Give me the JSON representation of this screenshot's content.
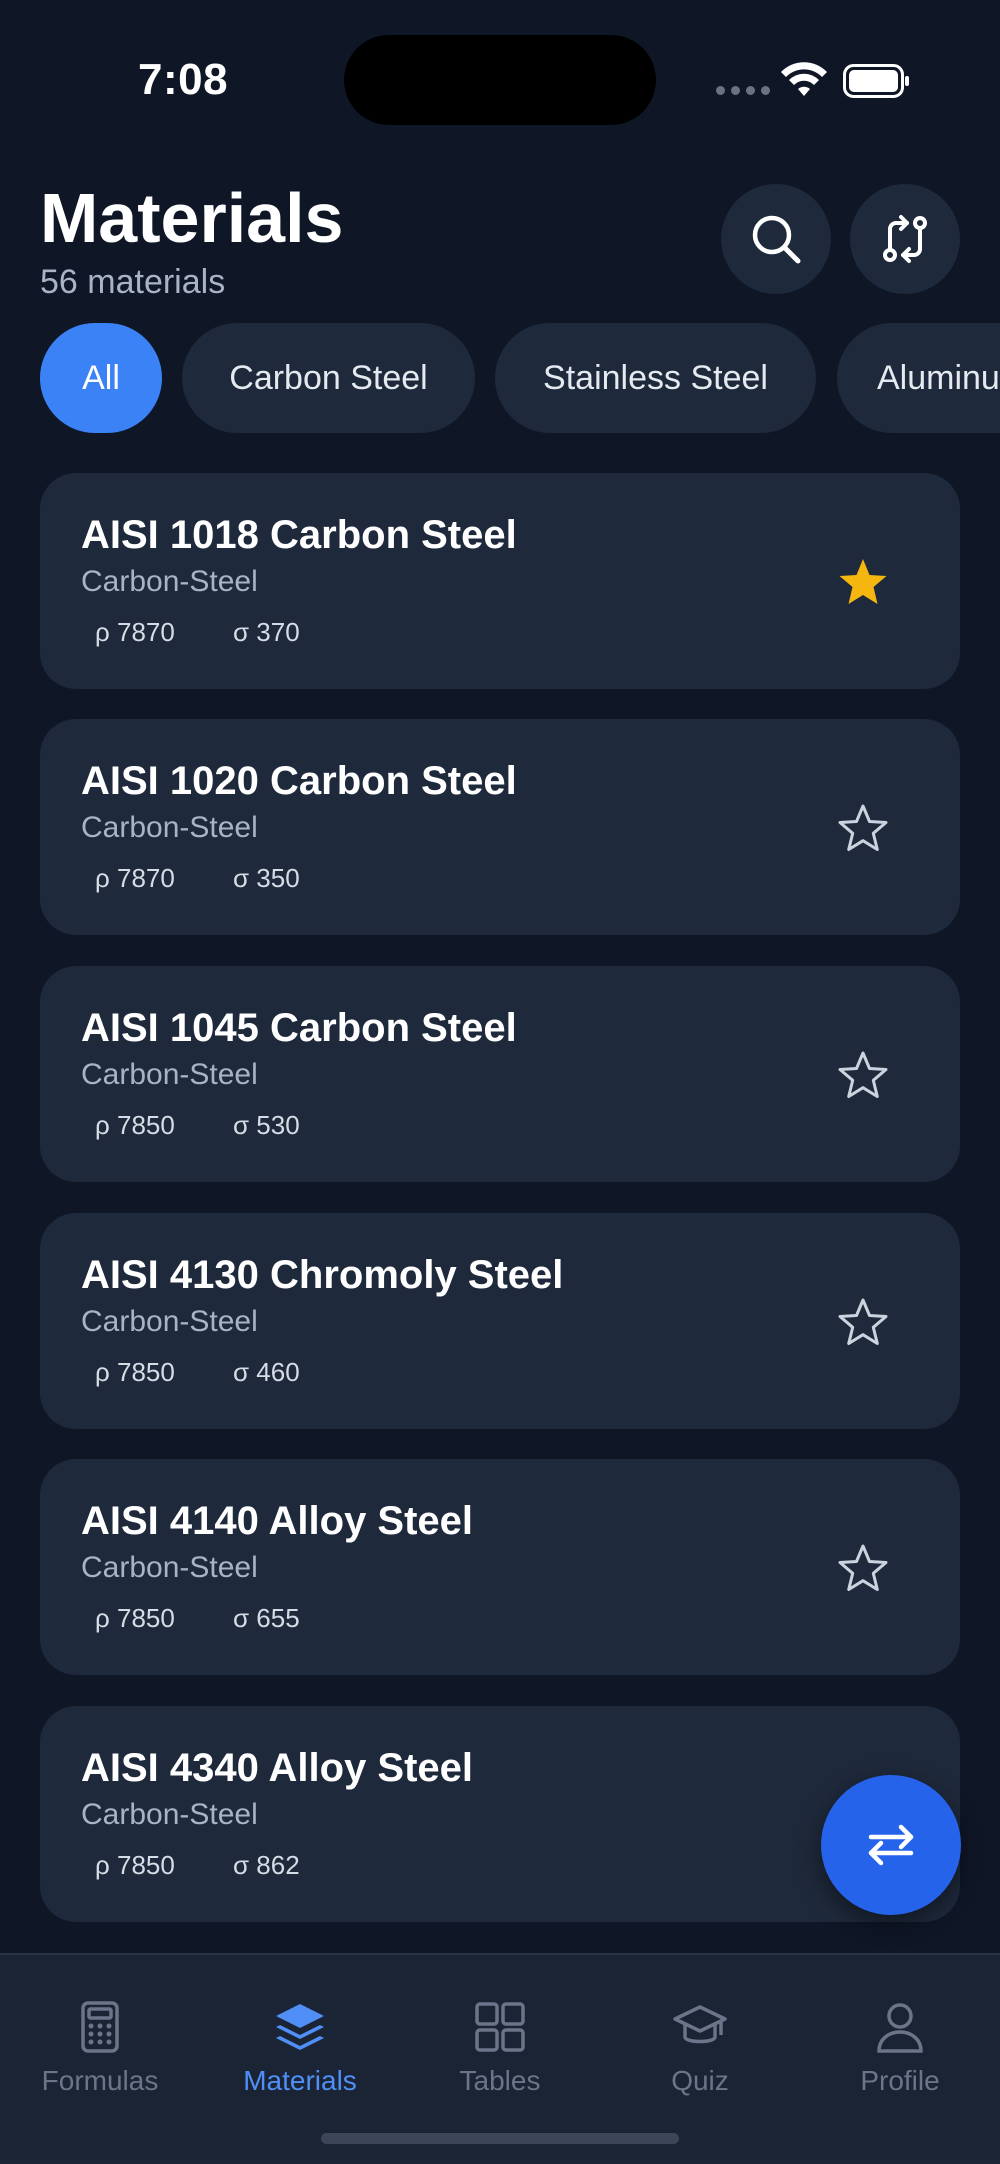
{
  "status_bar": {
    "time": "7:08"
  },
  "header": {
    "title": "Materials",
    "subtitle": "56 materials",
    "search_icon": "search-icon",
    "compare_icon": "compare-arrows-icon"
  },
  "chips": [
    {
      "label": "All",
      "active": true
    },
    {
      "label": "Carbon Steel",
      "active": false
    },
    {
      "label": "Stainless Steel",
      "active": false
    },
    {
      "label": "Aluminum",
      "active": false
    }
  ],
  "materials": [
    {
      "name": "AISI 1018 Carbon Steel",
      "category": "Carbon-Steel",
      "density": "ρ 7870",
      "strength": "σ 370",
      "favorite": true
    },
    {
      "name": "AISI 1020 Carbon Steel",
      "category": "Carbon-Steel",
      "density": "ρ 7870",
      "strength": "σ 350",
      "favorite": false
    },
    {
      "name": "AISI 1045 Carbon Steel",
      "category": "Carbon-Steel",
      "density": "ρ 7850",
      "strength": "σ 530",
      "favorite": false
    },
    {
      "name": "AISI 4130 Chromoly Steel",
      "category": "Carbon-Steel",
      "density": "ρ 7850",
      "strength": "σ 460",
      "favorite": false
    },
    {
      "name": "AISI 4140 Alloy Steel",
      "category": "Carbon-Steel",
      "density": "ρ 7850",
      "strength": "σ 655",
      "favorite": false
    },
    {
      "name": "AISI 4340 Alloy Steel",
      "category": "Carbon-Steel",
      "density": "ρ 7850",
      "strength": "σ 862",
      "favorite": false
    }
  ],
  "tabs": [
    {
      "label": "Formulas",
      "icon": "calculator-icon",
      "active": false
    },
    {
      "label": "Materials",
      "icon": "layers-icon",
      "active": true
    },
    {
      "label": "Tables",
      "icon": "grid-icon",
      "active": false
    },
    {
      "label": "Quiz",
      "icon": "graduation-cap-icon",
      "active": false
    },
    {
      "label": "Profile",
      "icon": "person-icon",
      "active": false
    }
  ],
  "colors": {
    "background": "#0f1626",
    "card": "#1e293b",
    "accent": "#3b82f6",
    "favorite_star": "#f5b70f"
  }
}
